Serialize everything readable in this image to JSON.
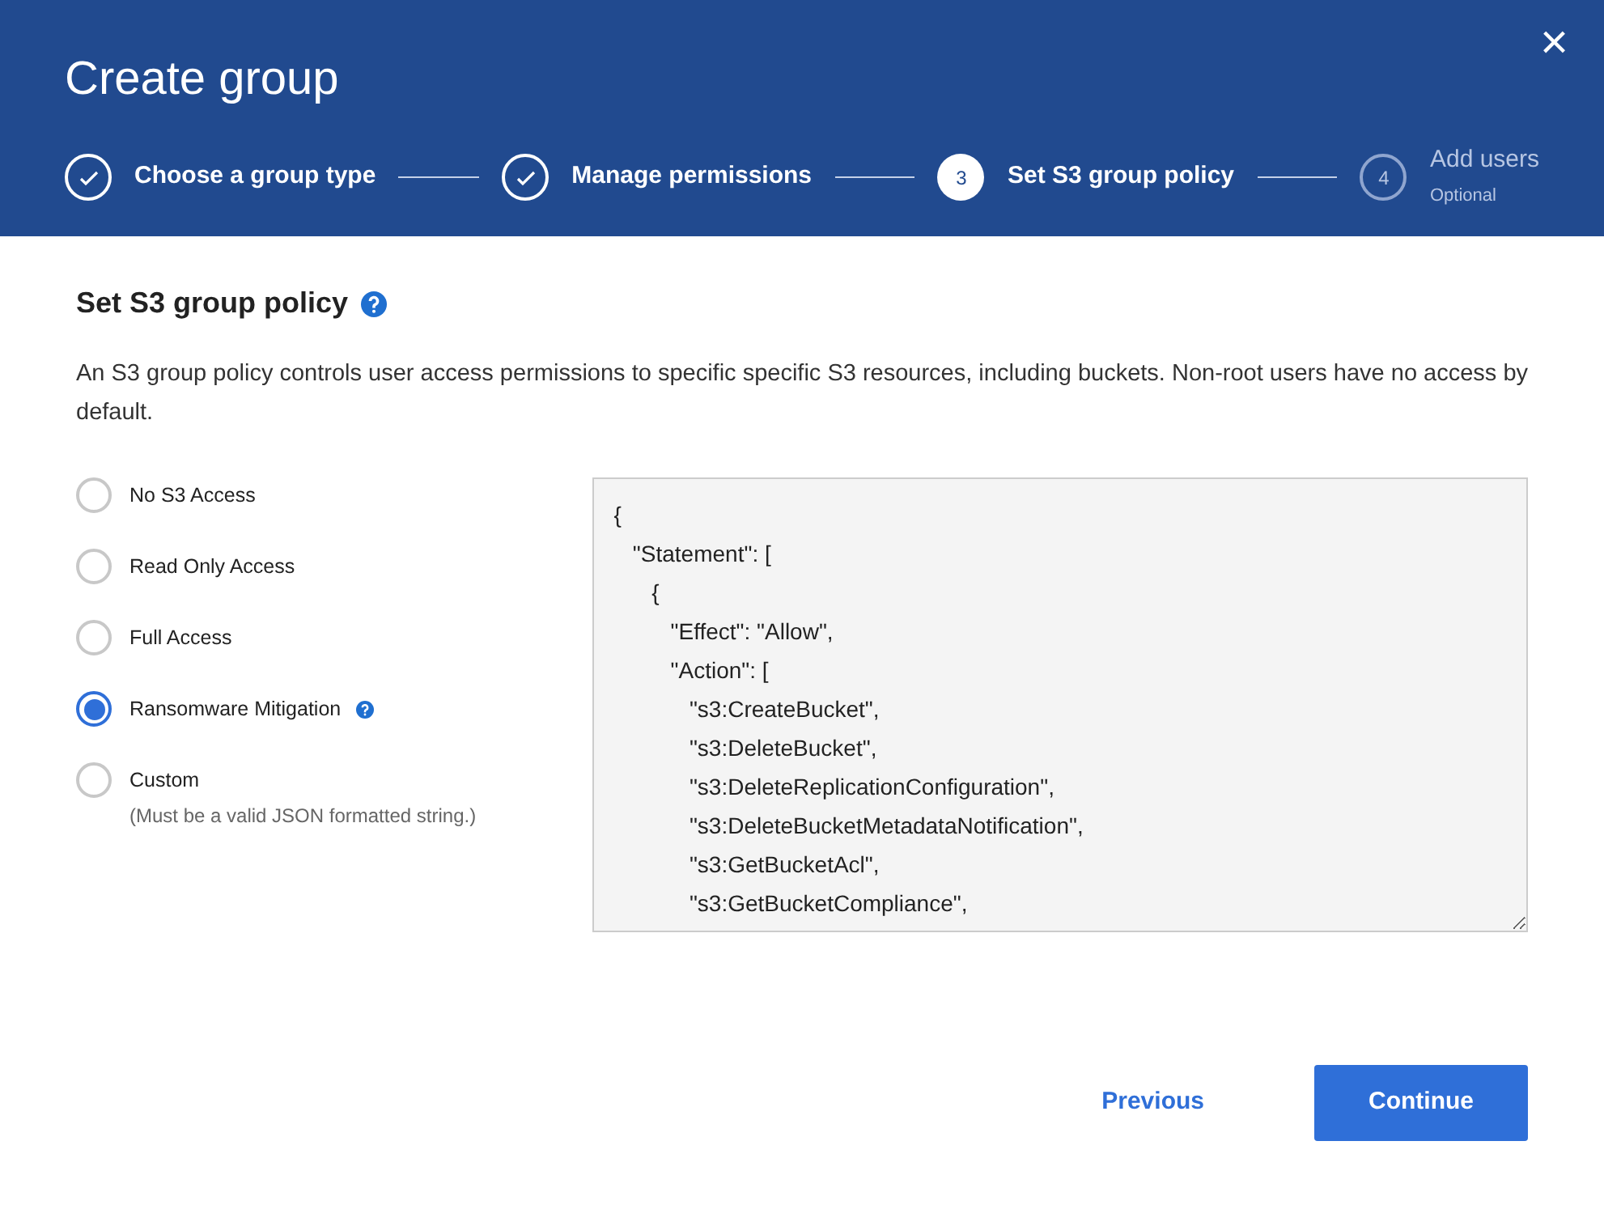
{
  "dialog": {
    "title": "Create group",
    "close": "×"
  },
  "steps": [
    {
      "label": "Choose a group type",
      "completed": true,
      "selected": false
    },
    {
      "label": "Manage permissions",
      "completed": true,
      "selected": false
    },
    {
      "number": "3",
      "label": "Set S3 group policy",
      "completed": false,
      "selected": true
    },
    {
      "number": "4",
      "label": "Add users",
      "sublabel": "Optional",
      "completed": false,
      "selected": false
    }
  ],
  "section": {
    "title": "Set S3 group policy",
    "help": true,
    "description": "An S3 group policy controls user access permissions to specific specific S3 resources, including buckets. Non-root users have no access by default."
  },
  "options": [
    {
      "label": "No S3 Access",
      "selected": false,
      "help": false
    },
    {
      "label": "Read Only Access",
      "selected": false,
      "help": false
    },
    {
      "label": "Full Access",
      "selected": false,
      "help": false
    },
    {
      "label": "Ransomware Mitigation",
      "selected": true,
      "help": true
    },
    {
      "label": "Custom",
      "hint": "(Must be a valid JSON formatted string.)",
      "selected": false,
      "help": false
    }
  ],
  "policy_text": "{\n   \"Statement\": [\n      {\n         \"Effect\": \"Allow\",\n         \"Action\": [\n            \"s3:CreateBucket\",\n            \"s3:DeleteBucket\",\n            \"s3:DeleteReplicationConfiguration\",\n            \"s3:DeleteBucketMetadataNotification\",\n            \"s3:GetBucketAcl\",\n            \"s3:GetBucketCompliance\",",
  "buttons": {
    "previous": "Previous",
    "continue": "Continue"
  }
}
